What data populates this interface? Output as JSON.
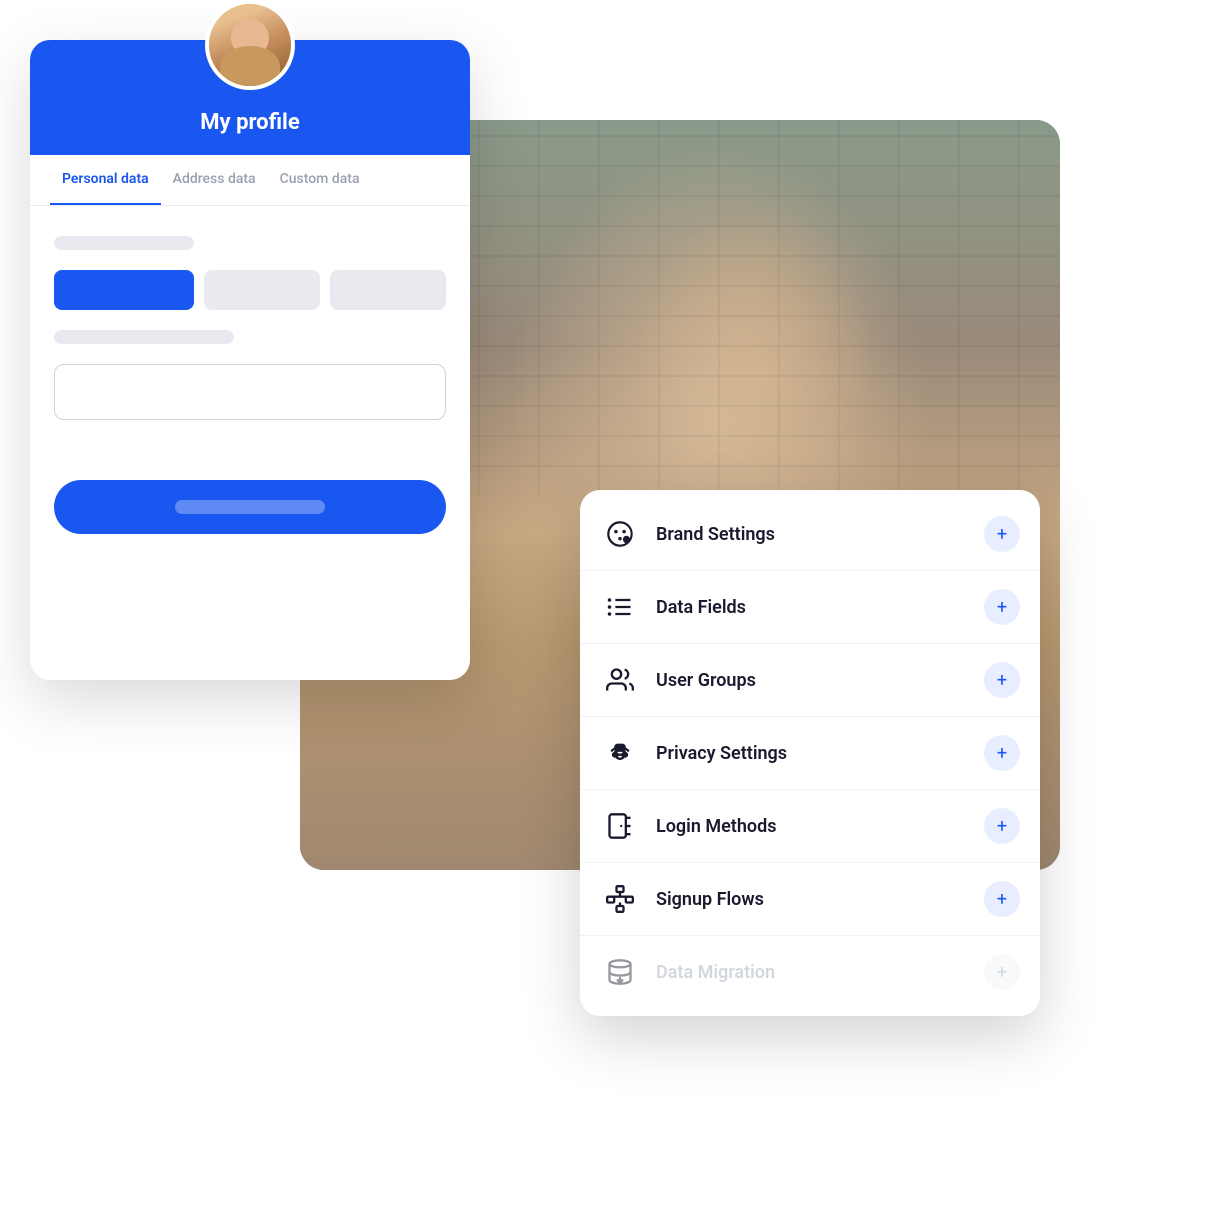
{
  "profile": {
    "title": "My profile",
    "tabs": [
      {
        "id": "personal",
        "label": "Personal data",
        "active": true
      },
      {
        "id": "address",
        "label": "Address data",
        "active": false
      },
      {
        "id": "custom",
        "label": "Custom data",
        "active": false
      }
    ]
  },
  "settings_menu": {
    "items": [
      {
        "id": "brand-settings",
        "label": "Brand Settings",
        "icon": "palette",
        "disabled": false
      },
      {
        "id": "data-fields",
        "label": "Data Fields",
        "icon": "list",
        "disabled": false
      },
      {
        "id": "user-groups",
        "label": "User Groups",
        "icon": "users",
        "disabled": false
      },
      {
        "id": "privacy-settings",
        "label": "Privacy Settings",
        "icon": "spy",
        "disabled": false
      },
      {
        "id": "login-methods",
        "label": "Login Methods",
        "icon": "door",
        "disabled": false
      },
      {
        "id": "signup-flows",
        "label": "Signup Flows",
        "icon": "flow",
        "disabled": false
      },
      {
        "id": "data-migration",
        "label": "Data Migration",
        "icon": "database",
        "disabled": true
      }
    ],
    "plus_label": "+"
  }
}
